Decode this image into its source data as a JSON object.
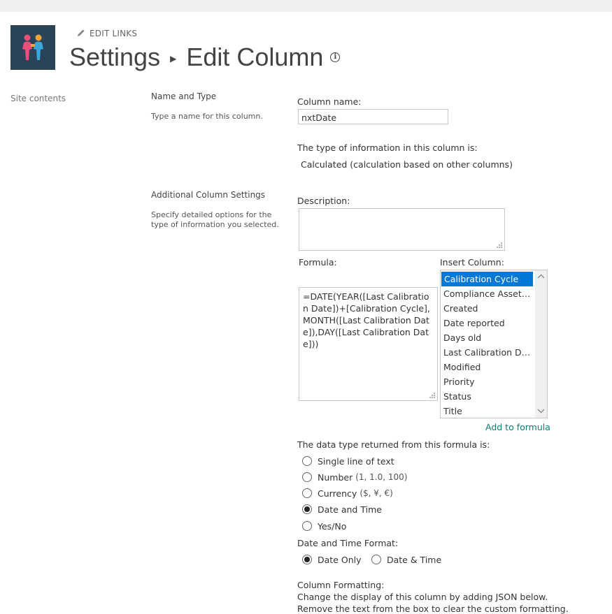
{
  "header": {
    "edit_links": "EDIT LINKS",
    "title_left": "Settings",
    "title_right": "Edit Column"
  },
  "left_nav": {
    "site_contents": "Site contents"
  },
  "name_type": {
    "heading": "Name and Type",
    "description": "Type a name for this column.",
    "column_name_label": "Column name:",
    "column_name_value": "nxtDate",
    "type_label": "The type of information in this column is:",
    "type_value": "Calculated (calculation based on other columns)"
  },
  "additional": {
    "heading": "Additional Column Settings",
    "description": "Specify detailed options for the type of information you selected.",
    "description_label": "Description:",
    "description_value": "",
    "formula_label": "Formula:",
    "formula_value": "=DATE(YEAR([Last Calibration Date])+[Calibration Cycle],MONTH([Last Calibration Date]),DAY([Last Calibration Date]))",
    "insert_column_label": "Insert Column:",
    "insert_columns": [
      "Calibration Cycle",
      "Compliance Asset Id",
      "Created",
      "Date reported",
      "Days old",
      "Last Calibration Dat...",
      "Modified",
      "Priority",
      "Status",
      "Title"
    ],
    "selected_column": "Calibration Cycle",
    "add_to_formula": "Add to formula",
    "return_type_label": "The data type returned from this formula is:",
    "return_types": [
      {
        "label": "Single line of text",
        "hint": "",
        "checked": false
      },
      {
        "label": "Number",
        "hint": "(1, 1.0, 100)",
        "checked": false
      },
      {
        "label": "Currency",
        "hint": "($, ¥, €)",
        "checked": false
      },
      {
        "label": "Date and Time",
        "hint": "",
        "checked": true
      },
      {
        "label": "Yes/No",
        "hint": "",
        "checked": false
      }
    ],
    "date_format_label": "Date and Time Format:",
    "date_formats": [
      {
        "label": "Date Only",
        "checked": true
      },
      {
        "label": "Date & Time",
        "checked": false
      }
    ],
    "column_formatting_label": "Column Formatting:",
    "column_formatting_desc": "Change the display of this column by adding JSON below.",
    "column_formatting_desc2": "Remove the text from the box to clear the custom formatting."
  },
  "colors": {
    "selected_bg": "#0078d7",
    "link": "#0f7b74",
    "logo_bg": "#2b4356"
  }
}
